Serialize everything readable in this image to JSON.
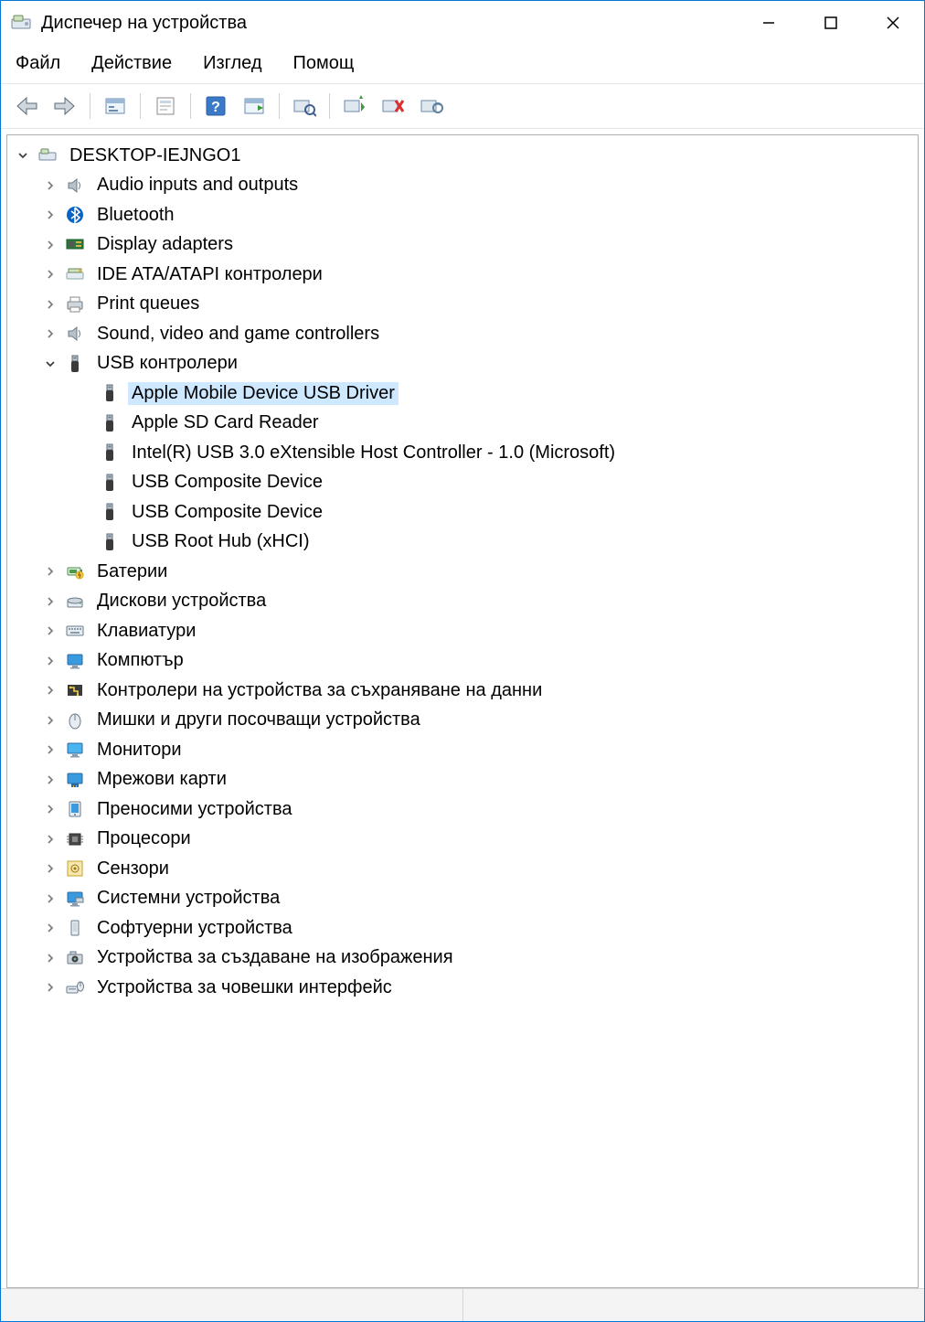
{
  "window": {
    "title": "Диспечер на устройства"
  },
  "menu": {
    "file": "Файл",
    "action": "Действие",
    "view": "Изглед",
    "help": "Помощ"
  },
  "toolbar": {
    "back": "back",
    "forward": "forward",
    "show_hidden": "show-hidden",
    "properties": "properties",
    "help": "help",
    "refresh": "refresh",
    "scan": "scan-hardware",
    "enable": "enable-device",
    "disable": "disable-device",
    "uninstall": "uninstall-device"
  },
  "tree": {
    "root": {
      "label": "DESKTOP-IEJNGO1",
      "expanded": true,
      "icon": "computer"
    },
    "nodes": [
      {
        "label": "Audio inputs and outputs",
        "icon": "speaker",
        "expanded": false,
        "children": []
      },
      {
        "label": "Bluetooth",
        "icon": "bluetooth",
        "expanded": false,
        "children": []
      },
      {
        "label": "Display adapters",
        "icon": "display-adapter",
        "expanded": false,
        "children": []
      },
      {
        "label": "IDE ATA/ATAPI контролери",
        "icon": "ide",
        "expanded": false,
        "children": []
      },
      {
        "label": "Print queues",
        "icon": "printer",
        "expanded": false,
        "children": []
      },
      {
        "label": "Sound, video and game controllers",
        "icon": "speaker",
        "expanded": false,
        "children": []
      },
      {
        "label": "USB контролери",
        "icon": "usb",
        "expanded": true,
        "children": [
          {
            "label": "Apple Mobile Device USB Driver",
            "icon": "usb",
            "selected": true
          },
          {
            "label": "Apple SD Card Reader",
            "icon": "usb"
          },
          {
            "label": "Intel(R) USB 3.0 eXtensible Host Controller - 1.0 (Microsoft)",
            "icon": "usb"
          },
          {
            "label": "USB Composite Device",
            "icon": "usb"
          },
          {
            "label": "USB Composite Device",
            "icon": "usb"
          },
          {
            "label": "USB Root Hub (xHCI)",
            "icon": "usb"
          }
        ]
      },
      {
        "label": "Батерии",
        "icon": "battery",
        "expanded": false,
        "children": []
      },
      {
        "label": "Дискови устройства",
        "icon": "disk",
        "expanded": false,
        "children": []
      },
      {
        "label": "Клавиатури",
        "icon": "keyboard",
        "expanded": false,
        "children": []
      },
      {
        "label": "Компютър",
        "icon": "monitor",
        "expanded": false,
        "children": []
      },
      {
        "label": "Контролери на устройства за съхраняване на данни",
        "icon": "storage-ctrl",
        "expanded": false,
        "children": []
      },
      {
        "label": "Мишки и други посочващи устройства",
        "icon": "mouse",
        "expanded": false,
        "children": []
      },
      {
        "label": "Монитори",
        "icon": "monitor2",
        "expanded": false,
        "children": []
      },
      {
        "label": "Мрежови карти",
        "icon": "network",
        "expanded": false,
        "children": []
      },
      {
        "label": "Преносими устройства",
        "icon": "portable",
        "expanded": false,
        "children": []
      },
      {
        "label": "Процесори",
        "icon": "cpu",
        "expanded": false,
        "children": []
      },
      {
        "label": "Сензори",
        "icon": "sensor",
        "expanded": false,
        "children": []
      },
      {
        "label": "Системни устройства",
        "icon": "system",
        "expanded": false,
        "children": []
      },
      {
        "label": "Софтуерни устройства",
        "icon": "software",
        "expanded": false,
        "children": []
      },
      {
        "label": "Устройства за създаване на изображения",
        "icon": "camera",
        "expanded": false,
        "children": []
      },
      {
        "label": "Устройства за човешки интерфейс",
        "icon": "hid",
        "expanded": false,
        "children": []
      }
    ]
  }
}
